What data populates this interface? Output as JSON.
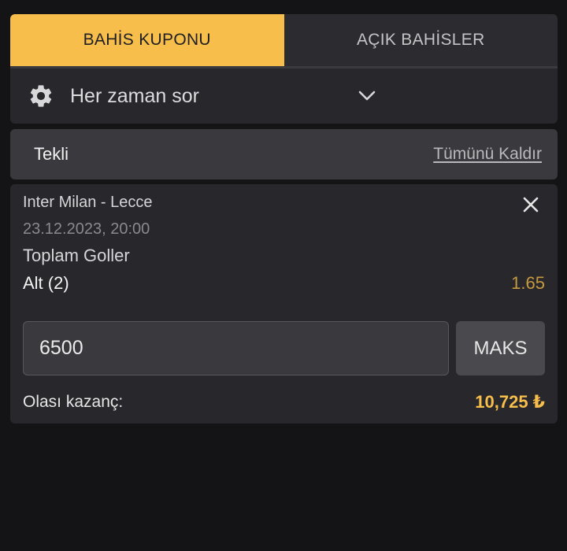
{
  "tabs": [
    {
      "label": "BAHİS KUPONU",
      "active": true
    },
    {
      "label": "AÇIK BAHİSLER",
      "active": false
    }
  ],
  "settings": {
    "label": "Her zaman sor",
    "icon": "gear-icon",
    "dropdown_icon": "chevron-down-icon"
  },
  "betslip": {
    "type_label": "Tekli",
    "remove_all_label": "Tümünü Kaldır"
  },
  "bet": {
    "match": "Inter Milan - Lecce",
    "datetime": "23.12.2023, 20:00",
    "market": "Toplam Goller",
    "selection": "Alt (2)",
    "odds": "1.65",
    "stake_value": "6500",
    "max_label": "MAKS",
    "potential_win_label": "Olası kazanç:",
    "potential_win_value": "10,725 ₺"
  },
  "colors": {
    "accent": "#f8be4b",
    "background": "#141316",
    "card": "#28272b",
    "odds": "#c79a3e"
  }
}
